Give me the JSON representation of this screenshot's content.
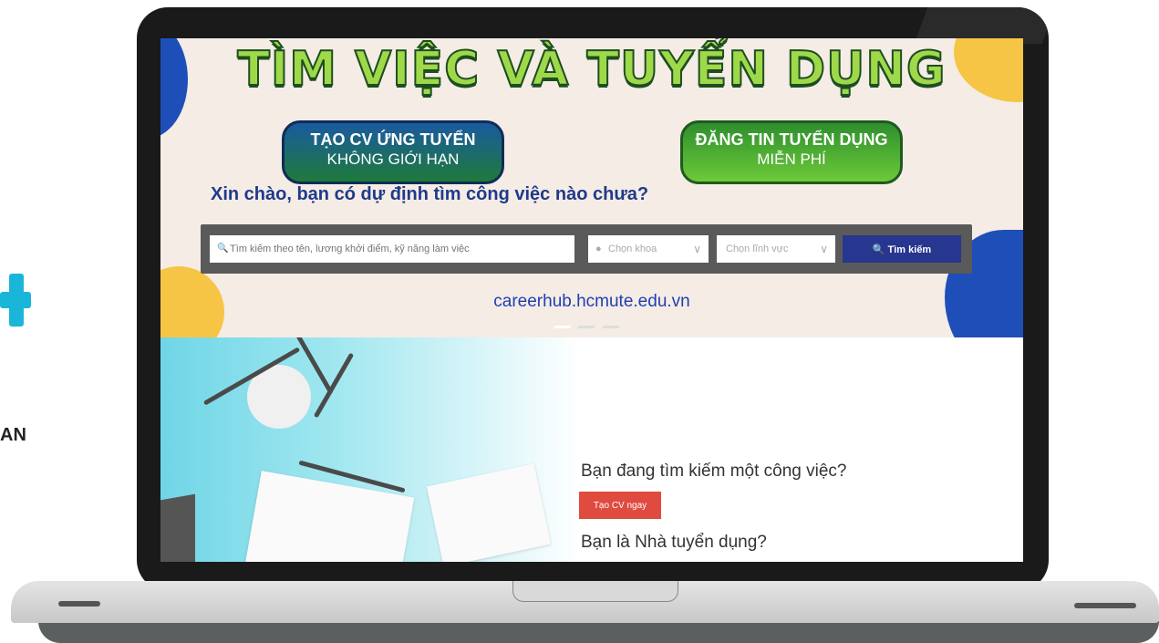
{
  "side": {
    "fragment_text": "AN"
  },
  "banner": {
    "headline": "TÌM VIỆC VÀ TUYỂN DỤNG",
    "pill_left": {
      "line1": "TẠO CV ỨNG TUYỂN",
      "line2": "KHÔNG GIỚI HẠN"
    },
    "pill_right": {
      "line1": "ĐĂNG TIN TUYỂN DỤNG",
      "line2": "MIỄN PHÍ"
    },
    "greeting": "Xin chào, bạn có dự định tìm công việc nào chưa?",
    "site_url": "careerhub.hcmute.edu.vn"
  },
  "search": {
    "placeholder": "Tìm kiếm theo tên, lương khởi điểm, kỹ năng làm việc",
    "khoa_label": "Chọn khoa",
    "linhvuc_label": "Chọn lĩnh vực",
    "button_label": "Tìm kiếm"
  },
  "lower": {
    "question_job": "Bạn đang tìm kiếm một công việc?",
    "cta_label": "Tạo CV ngay",
    "question_employer": "Bạn là Nhà tuyển dụng?"
  },
  "colors": {
    "accent": "#27368f",
    "cta": "#e04b3f",
    "headline_green": "#9fd94a"
  }
}
